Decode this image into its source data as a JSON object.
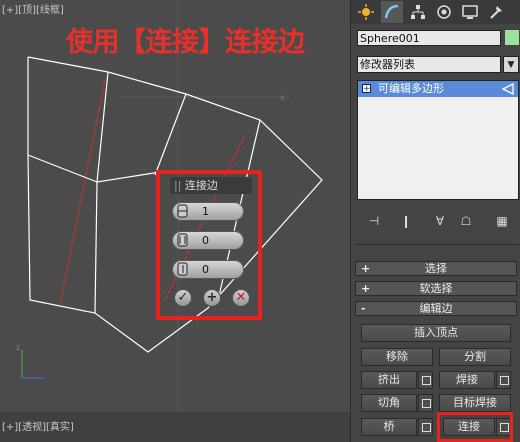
{
  "viewport": {
    "top_label": "[+][顶][线框]",
    "bottom_label": "[+][透视][真实]"
  },
  "overlay": {
    "title": "使用【连接】连接边"
  },
  "connect_popup": {
    "title": "连接边",
    "segments_value": "1",
    "pinch_value": "0",
    "slide_value": "0",
    "ok_icon": "check-icon",
    "apply_icon": "plus-icon",
    "cancel_icon": "x-icon"
  },
  "command_panel": {
    "tabs": [
      "create-icon",
      "modify-icon",
      "hierarchy-icon",
      "motion-icon",
      "display-icon",
      "utilities-icon"
    ],
    "object_name": "Sphere001",
    "object_color": "#9be09b",
    "modifier_list": "修改器列表",
    "stack_item": "可编辑多边形",
    "rollouts": {
      "select": "选择",
      "soft_select": "软选择",
      "edit_edges": "编辑边"
    },
    "buttons": {
      "insert_vertex": "插入顶点",
      "remove": "移除",
      "split": "分割",
      "extrude": "挤出",
      "weld": "焊接",
      "chamfer": "切角",
      "target_weld": "目标焊接",
      "bridge": "桥",
      "connect": "连接"
    }
  },
  "colors": {
    "highlight": "#e8221c",
    "selection": "#5b8bd8"
  }
}
